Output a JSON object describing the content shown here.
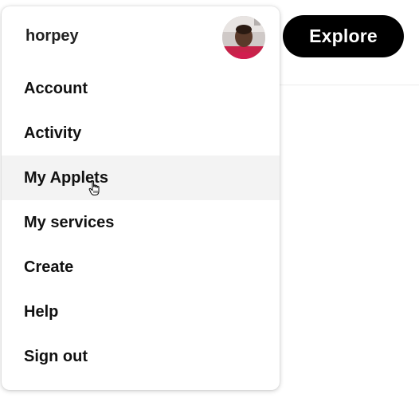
{
  "user": {
    "username": "horpey",
    "avatar_icon": "user-avatar-photo"
  },
  "header": {
    "explore_label": "Explore"
  },
  "menu": {
    "items": [
      {
        "label": "Account"
      },
      {
        "label": "Activity"
      },
      {
        "label": "My Applets",
        "hovered": true
      },
      {
        "label": "My services"
      },
      {
        "label": "Create"
      },
      {
        "label": "Help"
      },
      {
        "label": "Sign out"
      }
    ]
  },
  "colors": {
    "explore_bg": "#000000",
    "hover_bg": "#f3f3f3",
    "text": "#111111"
  }
}
